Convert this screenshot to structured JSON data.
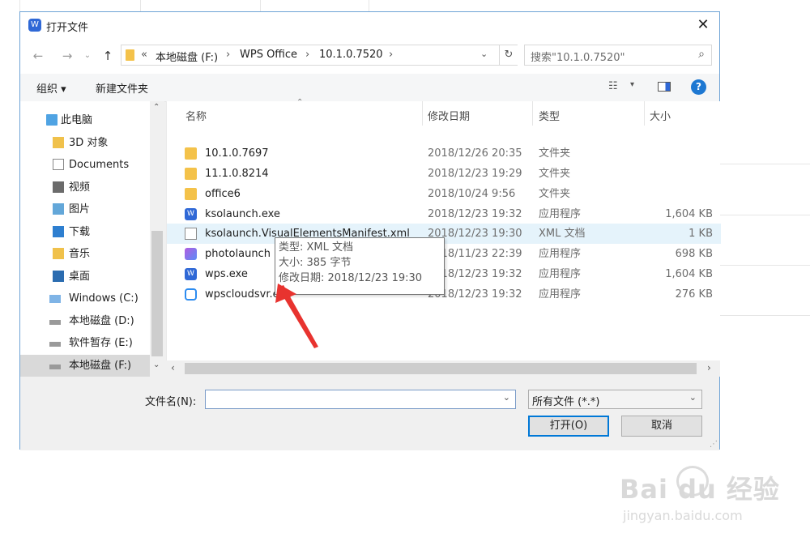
{
  "dialog": {
    "title": "打开文件",
    "close_label": "✕"
  },
  "address": {
    "overflow_label": "«",
    "crumbs": [
      "本地磁盘 (F:)",
      "WPS Office",
      "10.1.0.7520"
    ],
    "separator": "›",
    "search_placeholder": "搜索\"10.1.0.7520\""
  },
  "toolbar": {
    "organize_label": "组织 ▾",
    "new_folder_label": "新建文件夹"
  },
  "sidebar": {
    "items": [
      {
        "label": "此电脑",
        "icon": "computer-icon"
      },
      {
        "label": "3D 对象",
        "icon": "3d-objects-icon"
      },
      {
        "label": "Documents",
        "icon": "documents-icon"
      },
      {
        "label": "视频",
        "icon": "video-icon"
      },
      {
        "label": "图片",
        "icon": "pictures-icon"
      },
      {
        "label": "下载",
        "icon": "downloads-icon"
      },
      {
        "label": "音乐",
        "icon": "music-icon"
      },
      {
        "label": "桌面",
        "icon": "desktop-icon"
      },
      {
        "label": "Windows (C:)",
        "icon": "windows-drive-icon"
      },
      {
        "label": "本地磁盘 (D:)",
        "icon": "drive-icon"
      },
      {
        "label": "软件暂存 (E:)",
        "icon": "drive-icon"
      },
      {
        "label": "本地磁盘 (F:)",
        "icon": "drive-icon"
      }
    ]
  },
  "filelist": {
    "headers": {
      "name": "名称",
      "date": "修改日期",
      "type": "类型",
      "size": "大小"
    },
    "rows": [
      {
        "name": "10.1.0.7697",
        "date": "2018/12/26 20:35",
        "type": "文件夹",
        "size": "",
        "icon": "folder-icon"
      },
      {
        "name": "11.1.0.8214",
        "date": "2018/12/23 19:29",
        "type": "文件夹",
        "size": "",
        "icon": "folder-icon"
      },
      {
        "name": "office6",
        "date": "2018/10/24 9:56",
        "type": "文件夹",
        "size": "",
        "icon": "folder-icon"
      },
      {
        "name": "ksolaunch.exe",
        "date": "2018/12/23 19:32",
        "type": "应用程序",
        "size": "1,604 KB",
        "icon": "wps-app-icon"
      },
      {
        "name": "ksolaunch.VisualElementsManifest.xml",
        "date": "2018/12/23 19:30",
        "type": "XML 文档",
        "size": "1 KB",
        "icon": "xml-document-icon"
      },
      {
        "name": "photolaunch",
        "date": "2018/11/23 22:39",
        "type": "应用程序",
        "size": "698 KB",
        "icon": "photo-app-icon"
      },
      {
        "name": "wps.exe",
        "date": "2018/12/23 19:32",
        "type": "应用程序",
        "size": "1,604 KB",
        "icon": "wps-app-icon"
      },
      {
        "name": "wpscloudsvr.exe",
        "date": "2018/12/23 19:32",
        "type": "应用程序",
        "size": "276 KB",
        "icon": "cloud-app-icon"
      }
    ]
  },
  "tooltip": {
    "line1": "类型: XML 文档",
    "line2": "大小: 385 字节",
    "line3": "修改日期: 2018/12/23 19:30"
  },
  "bottom": {
    "filename_label": "文件名(N):",
    "filename_value": "",
    "filetype_value": "所有文件 (*.*)",
    "open_label": "打开(O)",
    "cancel_label": "取消"
  },
  "watermark": {
    "brand": "Bai du 经验",
    "url": "jingyan.baidu.com"
  },
  "colors": {
    "accent": "#0078d7",
    "arrow": "#e8332f",
    "selected_row": "#e5f3fb"
  }
}
